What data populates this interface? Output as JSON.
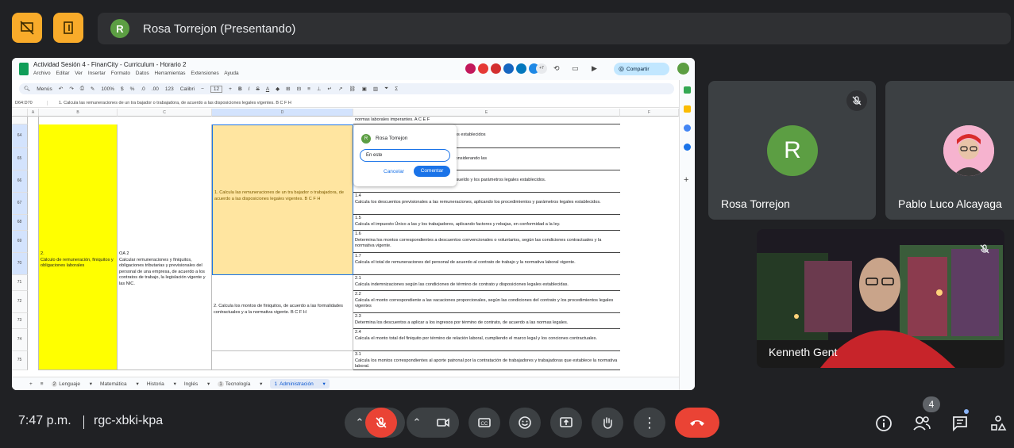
{
  "top": {
    "presenter_initial": "R",
    "presenter_label": "Rosa Torrejon (Presentando)"
  },
  "sheet": {
    "doc_title": "Actividad Sesión 4 - FinanCity - Curriculum - Horario 2",
    "menus": [
      "Archivo",
      "Editar",
      "Ver",
      "Insertar",
      "Formato",
      "Datos",
      "Herramientas",
      "Extensiones",
      "Ayuda"
    ],
    "share_label": "Compartir",
    "collab_count": "+7",
    "toolbar": {
      "menus_label": "Menús",
      "zoom": "100%",
      "currency": "$",
      "percent": "%",
      "format_123": "123",
      "font": "Calibri",
      "font_size": "12"
    },
    "cell_ref": "D64:D70",
    "formula": "1. Calcula las remuneraciones de un tra bajador o trabajadora, de acuerdo a las disposiciones legales vigentes. B C F H",
    "columns": [
      "A",
      "B",
      "C",
      "D",
      "E",
      "F"
    ],
    "rows": [
      "64",
      "65",
      "66",
      "67",
      "68",
      "69",
      "70",
      "71",
      "72",
      "73",
      "74",
      "75"
    ],
    "cell_b": "2.\nCálculo de remuneración, finiquitos y obligaciones laborales",
    "cell_c": "OA 2\nCalcular remuneraciones y finiquitos, obligaciones tributarias y previsionales del personal de una empresa, de acuerdo a los contratos de trabajo, la legislación vigente y las NIC.",
    "cell_d1": "1. Calcula las remuneraciones de un tra bajador o trabajadora, de acuerdo a las disposiciones legales vigentes. B C F H",
    "cell_d2": "2. Calcula los montos de finiquitos, de acuerdo a las formalidades contractuales y a la normativa vigente. B C F H",
    "top_line": "normas laborales imperantes. A C E F",
    "f_lines": [
      {
        "num": "",
        "text": "...jador o trabajador, atendiendo a los procedimientos establecidos"
      },
      {
        "num": "",
        "text": "...se constituyen ingresos a las y los trabajadores considerando las"
      },
      {
        "num": "",
        "text": "...haberes utilizando el formato de la liquidación de sueldo y los parámetros legales establecidos."
      },
      {
        "num": "1.4",
        "text": "Calcula los descuentos previsionales a las remuneraciones, aplicando los procedimientos y parámetros legales establecidos."
      },
      {
        "num": "1.5",
        "text": "Calcula el impuesto Único a las y los trabajadores, aplicando factores y rebajas, en conformidad a la ley."
      },
      {
        "num": "1.6",
        "text": "Determina los montos correspondientes a descuentos convencionales o voluntarios, según las condiciones contractuales y la normativa vigente."
      },
      {
        "num": "1.7",
        "text": "Calcula el total de remuneraciones del personal de acuerdo al contrato de trabajo y la normativa laboral vigente."
      },
      {
        "num": "2.1",
        "text": "Calcula indemnizaciones según las condiciones de término de contrato y disposiciones legales establecidas."
      },
      {
        "num": "2.2",
        "text": "Calcula el monto correspondiente a las vacaciones proporcionales, según las condiciones del contrato y los procedimientos legales vigentes"
      },
      {
        "num": "2.3",
        "text": "Determina los descuentos a aplicar a los ingresos por término de contrato, de acuerdo a las normas legales."
      },
      {
        "num": "2.4",
        "text": "Calcula el monto total del finiquito por término de relación laboral, cumpliendo el marco legal y los conciones contractuales."
      },
      {
        "num": "3.1",
        "text": "Calcula los montos correspondientes al aporte patronal por la contratación de trabajadores y trabajadoras que establece la normativa laboral."
      }
    ],
    "comment": {
      "initial": "R",
      "author": "Rosa Torrejon",
      "input_value": "En este",
      "cancel": "Cancelar",
      "submit": "Comentar"
    },
    "tabs": [
      {
        "label": "Lenguaje",
        "badge": "2"
      },
      {
        "label": "Matemática",
        "badge": ""
      },
      {
        "label": "Historia",
        "badge": ""
      },
      {
        "label": "Inglés",
        "badge": ""
      },
      {
        "label": "Tecnología",
        "badge": "1"
      },
      {
        "label": "Administración",
        "badge": "1"
      }
    ]
  },
  "participants": [
    {
      "name": "Rosa Torrejon",
      "initial": "R"
    },
    {
      "name": "Pablo Luco Alcayaga"
    },
    {
      "name": "Kenneth Gent"
    }
  ],
  "bottom": {
    "time": "7:47 p.m.",
    "meeting_code": "rgc-xbki-kpa",
    "people_count": "4"
  },
  "colors": {
    "accent_yellow": "#f9ab2a",
    "hangup_red": "#ea4335",
    "avatar_green": "#5c9e43",
    "cell_yellow": "#ffff00",
    "cell_peach": "#ffe5a0"
  }
}
